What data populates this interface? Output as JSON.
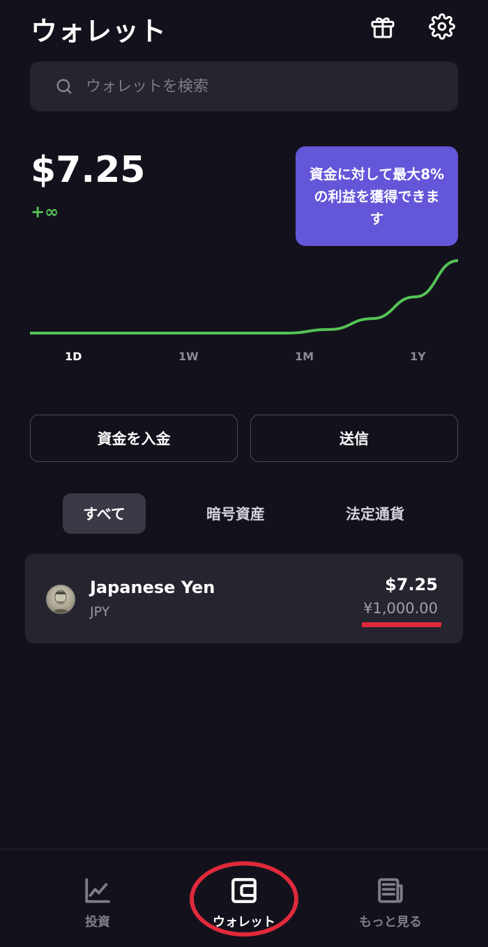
{
  "header": {
    "title": "ウォレット",
    "gift_icon": "gift-icon",
    "settings_icon": "gear-icon"
  },
  "search": {
    "placeholder": "ウォレットを検索"
  },
  "balance": {
    "amount": "$7.25",
    "change": "+∞"
  },
  "promo": {
    "text": "資金に対して最大8%の利益を獲得できます"
  },
  "chart_data": {
    "type": "line",
    "x": [
      0,
      1,
      2,
      3,
      4,
      5,
      6,
      7,
      8,
      9,
      10
    ],
    "series": [
      {
        "values": [
          0,
          0,
          0,
          0,
          0,
          0,
          0,
          0.5,
          2,
          5,
          10
        ]
      }
    ],
    "color": "#55c356"
  },
  "ranges": [
    "1D",
    "1W",
    "1M",
    "1Y"
  ],
  "actions": {
    "deposit": "資金を入金",
    "send": "送信"
  },
  "filters": [
    "すべて",
    "暗号資産",
    "法定通貨"
  ],
  "assets": [
    {
      "name": "Japanese Yen",
      "code": "JPY",
      "usd": "$7.25",
      "local": "¥1,000.00"
    }
  ],
  "nav": [
    {
      "label": "投資",
      "icon": "chart-icon"
    },
    {
      "label": "ウォレット",
      "icon": "wallet-icon"
    },
    {
      "label": "もっと見る",
      "icon": "news-icon"
    }
  ],
  "colors": {
    "accent_green": "#55c356",
    "promo_purple": "#6456d8",
    "annotation_red": "#e0293b"
  }
}
